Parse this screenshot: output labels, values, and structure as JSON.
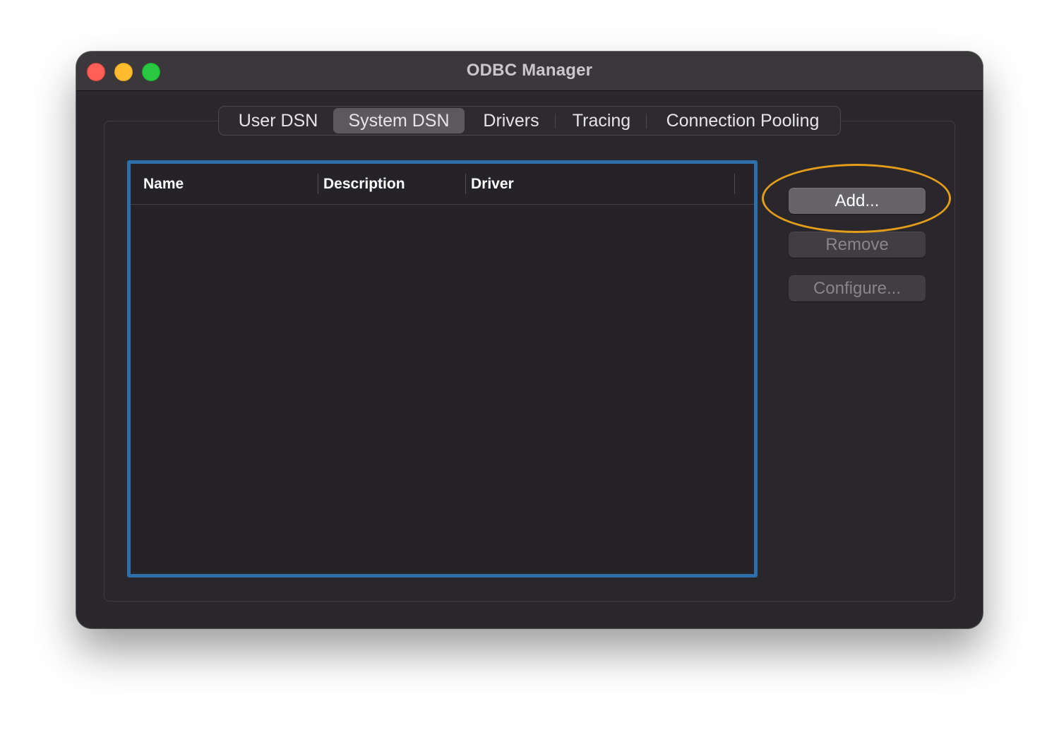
{
  "window": {
    "title": "ODBC Manager"
  },
  "tabs": [
    {
      "label": "User DSN",
      "selected": false
    },
    {
      "label": "System DSN",
      "selected": true
    },
    {
      "label": "Drivers",
      "selected": false
    },
    {
      "label": "Tracing",
      "selected": false
    },
    {
      "label": "Connection Pooling",
      "selected": false
    }
  ],
  "table": {
    "columns": [
      "Name",
      "Description",
      "Driver"
    ],
    "rows": []
  },
  "buttons": {
    "add_label": "Add...",
    "remove_label": "Remove",
    "configure_label": "Configure..."
  },
  "colors": {
    "table_focus_ring": "#2e6fa9",
    "annotation_highlight": "#e29d1a",
    "close": "#fe5f57",
    "minimize": "#febc2e",
    "zoom": "#28c840"
  },
  "icons": {
    "close": "close-icon",
    "minimize": "minimize-icon",
    "zoom": "zoom-icon"
  }
}
